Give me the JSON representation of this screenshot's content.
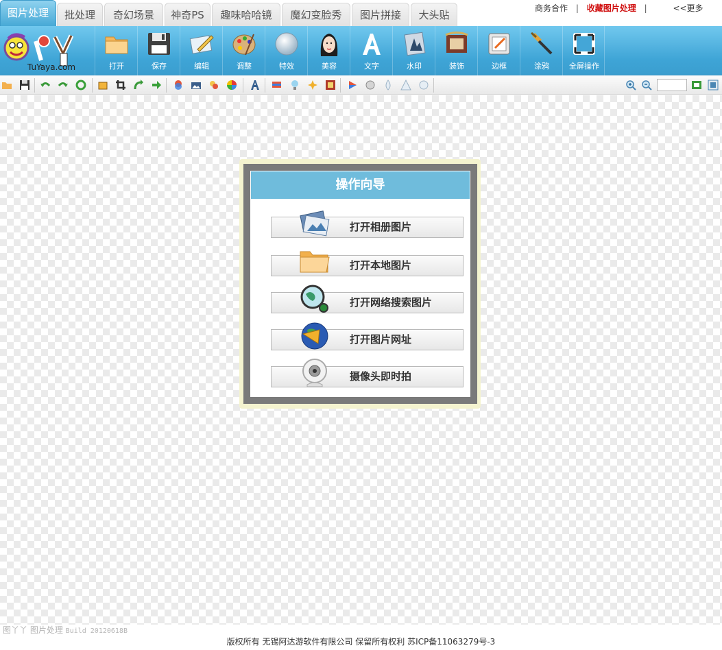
{
  "tabs": [
    {
      "label": "图片处理",
      "active": true
    },
    {
      "label": "批处理"
    },
    {
      "label": "奇幻场景"
    },
    {
      "label": "神奇PS"
    },
    {
      "label": "趣味哈哈镜"
    },
    {
      "label": "魔幻变脸秀"
    },
    {
      "label": "图片拼接"
    },
    {
      "label": "大头贴"
    }
  ],
  "top_links": {
    "business": "商务合作",
    "separator": "|",
    "favorite": "收藏图片处理",
    "more": "<<更多"
  },
  "logo": {
    "text": "TuYaya.com"
  },
  "main_toolbar": [
    {
      "label": "打开",
      "icon": "folder-icon"
    },
    {
      "label": "保存",
      "icon": "floppy-disk-icon"
    },
    {
      "label": "编辑",
      "icon": "edit-pen-icon"
    },
    {
      "label": "调整",
      "icon": "palette-icon"
    },
    {
      "label": "特效",
      "icon": "crystal-ball-icon"
    },
    {
      "label": "美容",
      "icon": "face-icon"
    },
    {
      "label": "文字",
      "icon": "text-a-icon"
    },
    {
      "label": "水印",
      "icon": "watermark-icon"
    },
    {
      "label": "装饰",
      "icon": "decoration-frame-icon"
    },
    {
      "label": "边框",
      "icon": "border-frame-icon"
    },
    {
      "label": "涂鸦",
      "icon": "brush-icon"
    },
    {
      "label": "全屏操作",
      "icon": "fullscreen-icon"
    }
  ],
  "small_toolbar": {
    "icons": [
      "open-small-icon",
      "save-small-icon",
      "undo-icon",
      "redo-icon",
      "refresh-icon",
      "resize-icon",
      "crop-icon",
      "rotate-icon",
      "next-icon",
      "layers-icon",
      "image-icon",
      "color-circle-icon",
      "color-wheel-icon",
      "text-icon",
      "flag-icon",
      "bulb-icon",
      "sparkle-icon",
      "frame-icon",
      "play-icon",
      "mask-icon",
      "drop-icon",
      "triangle-icon",
      "circle-icon"
    ],
    "zoom_in": "zoom-in-icon",
    "zoom_out": "zoom-out-icon",
    "zoom_value": "",
    "fit": "fit-window-icon",
    "actual": "actual-size-icon"
  },
  "wizard": {
    "title": "操作向导",
    "buttons": [
      {
        "label": "打开相册图片",
        "icon": "photo-album-icon"
      },
      {
        "label": "打开本地图片",
        "icon": "local-folder-icon"
      },
      {
        "label": "打开网络搜索图片",
        "icon": "web-search-icon"
      },
      {
        "label": "打开图片网址",
        "icon": "globe-url-icon"
      },
      {
        "label": "摄像头即时拍",
        "icon": "webcam-icon"
      }
    ]
  },
  "footer": {
    "build_name": "图丫丫 图片处理",
    "build_version": "Build 20120618B",
    "copyright": "版权所有 无锡阿达游软件有限公司 保留所有权利 苏ICP备11063279号-3"
  },
  "colors": {
    "accent_blue": "#3ea4d6",
    "wizard_header": "#6fbcdc",
    "favorite_red": "#d01010"
  }
}
